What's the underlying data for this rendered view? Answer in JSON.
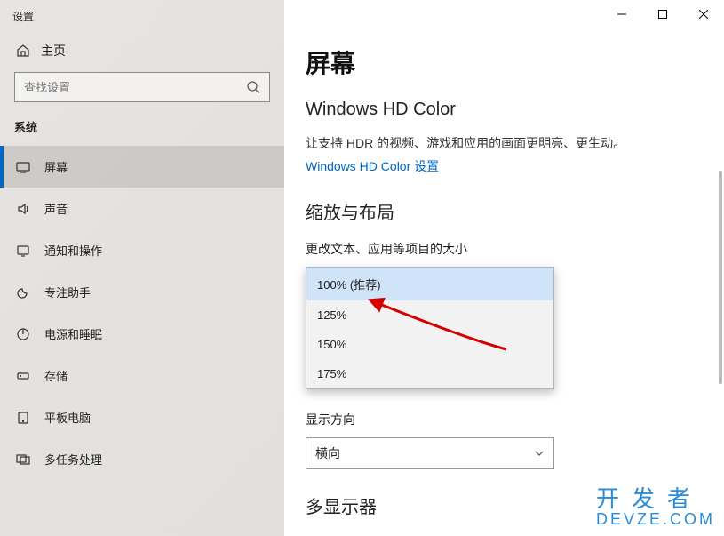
{
  "window": {
    "title": "设置"
  },
  "sidebar": {
    "home": "主页",
    "search_placeholder": "查找设置",
    "section": "系统",
    "items": [
      {
        "label": "屏幕"
      },
      {
        "label": "声音"
      },
      {
        "label": "通知和操作"
      },
      {
        "label": "专注助手"
      },
      {
        "label": "电源和睡眠"
      },
      {
        "label": "存储"
      },
      {
        "label": "平板电脑"
      },
      {
        "label": "多任务处理"
      }
    ]
  },
  "main": {
    "page_title": "屏幕",
    "hd_color": {
      "heading": "Windows HD Color",
      "desc": "让支持 HDR 的视频、游戏和应用的画面更明亮、更生动。",
      "link": "Windows HD Color 设置"
    },
    "scale": {
      "heading": "缩放与布局",
      "label": "更改文本、应用等项目的大小",
      "options": [
        "100% (推荐)",
        "125%",
        "150%",
        "175%"
      ],
      "selected_index": 0
    },
    "orientation": {
      "label": "显示方向",
      "value": "横向"
    },
    "multi": {
      "heading": "多显示器"
    }
  },
  "watermark": {
    "line1": "开发者",
    "line2": "DEVZE.COM"
  }
}
